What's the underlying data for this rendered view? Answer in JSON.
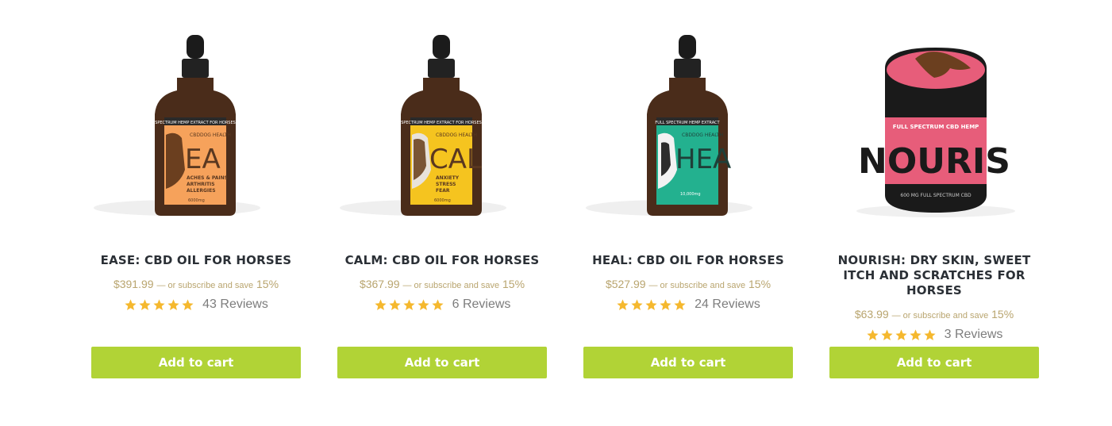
{
  "colors": {
    "button": "#b1d336",
    "button_text": "#ffffff",
    "title": "#2b3036",
    "price": "#b9a56f",
    "star": "#f5b82e",
    "reviews": "#7d7d7d"
  },
  "products": [
    {
      "title": "EASE: CBD OIL FOR HORSES",
      "price": "$391.99",
      "subscribe_text": "— or subscribe and save",
      "discount": "15%",
      "rating": 5,
      "reviews": "43 Reviews",
      "button": "Add to cart",
      "label_color": "#f6a25b",
      "label_text": "EA",
      "label_lines": [
        "ACHES & PAINS",
        "ARTHRITIS",
        "ALLERGIES"
      ],
      "brand": "CBDDOG HEALTH",
      "banner": "SPECTRUM HEMP EXTRACT FOR HORSES",
      "dose": "6000mg"
    },
    {
      "title": "CALM: CBD OIL FOR HORSES",
      "price": "$367.99",
      "subscribe_text": "— or subscribe and save",
      "discount": "15%",
      "rating": 5,
      "reviews": "6 Reviews",
      "button": "Add to cart",
      "label_color": "#f5c41f",
      "label_text": "CAL",
      "label_lines": [
        "ANXIETY",
        "STRESS",
        "FEAR"
      ],
      "brand": "CBDDOG HEALTH",
      "banner": "SPECTRUM HEMP EXTRACT FOR HORSES",
      "dose": "6000mg"
    },
    {
      "title": "HEAL: CBD OIL FOR HORSES",
      "price": "$527.99",
      "subscribe_text": "— or subscribe and save",
      "discount": "15%",
      "rating": 5,
      "reviews": "24 Reviews",
      "button": "Add to cart",
      "label_color": "#23b18f",
      "label_text": "HEA",
      "label_lines": [],
      "brand": "CBDDOG HEALTH",
      "banner": "FULL SPECTRUM HEMP EXTRACT",
      "dose": "10,000mg"
    },
    {
      "title": "NOURISH: DRY SKIN, SWEET ITCH AND SCRATCHES FOR HORSES",
      "price": "$63.99",
      "subscribe_text": "— or subscribe and save",
      "discount": "15%",
      "rating": 5,
      "reviews": "3 Reviews",
      "button": "Add to cart",
      "label_color": "#e75d7a",
      "label_text": "NOURIS",
      "label_lines": [],
      "brand": "",
      "banner": "FULL SPECTRUM CBD HEMP",
      "dose": "600 MG FULL SPECTRUM CBD"
    }
  ]
}
